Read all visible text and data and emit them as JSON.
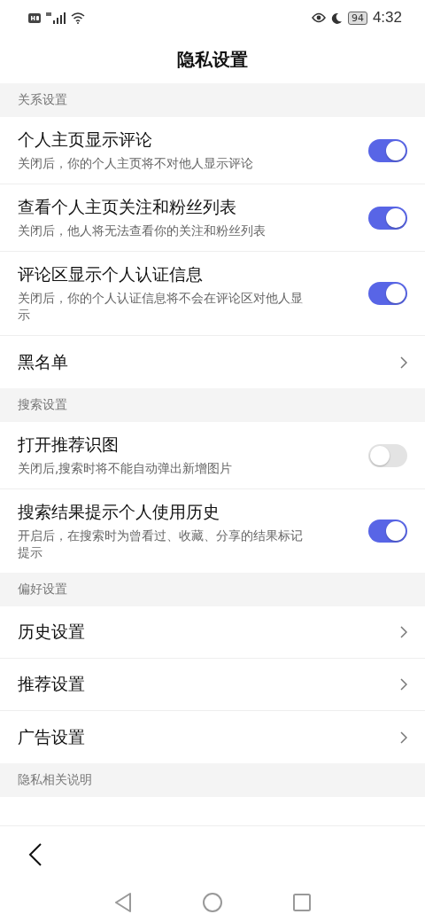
{
  "status_bar": {
    "battery": "94",
    "time": "4:32"
  },
  "title": "隐私设置",
  "sections": [
    {
      "header": "关系设置",
      "items": [
        {
          "kind": "toggle",
          "label": "个人主页显示评论",
          "description": "关闭后，你的个人主页将不对他人显示评论",
          "on": true
        },
        {
          "kind": "toggle",
          "label": "查看个人主页关注和粉丝列表",
          "description": "关闭后，他人将无法查看你的关注和粉丝列表",
          "on": true
        },
        {
          "kind": "toggle",
          "label": "评论区显示个人认证信息",
          "description": "关闭后，你的个人认证信息将不会在评论区对他人显示",
          "on": true
        },
        {
          "kind": "link",
          "label": "黑名单"
        }
      ]
    },
    {
      "header": "搜索设置",
      "items": [
        {
          "kind": "toggle",
          "label": "打开推荐识图",
          "description": "关闭后,搜索时将不能自动弹出新增图片",
          "on": false
        },
        {
          "kind": "toggle",
          "label": "搜索结果提示个人使用历史",
          "description": "开启后，在搜索时为曾看过、收藏、分享的结果标记提示",
          "on": true
        }
      ]
    },
    {
      "header": "偏好设置",
      "items": [
        {
          "kind": "link",
          "label": "历史设置"
        },
        {
          "kind": "link",
          "label": "推荐设置"
        },
        {
          "kind": "link",
          "label": "广告设置"
        }
      ]
    },
    {
      "header": "隐私相关说明"
    }
  ]
}
